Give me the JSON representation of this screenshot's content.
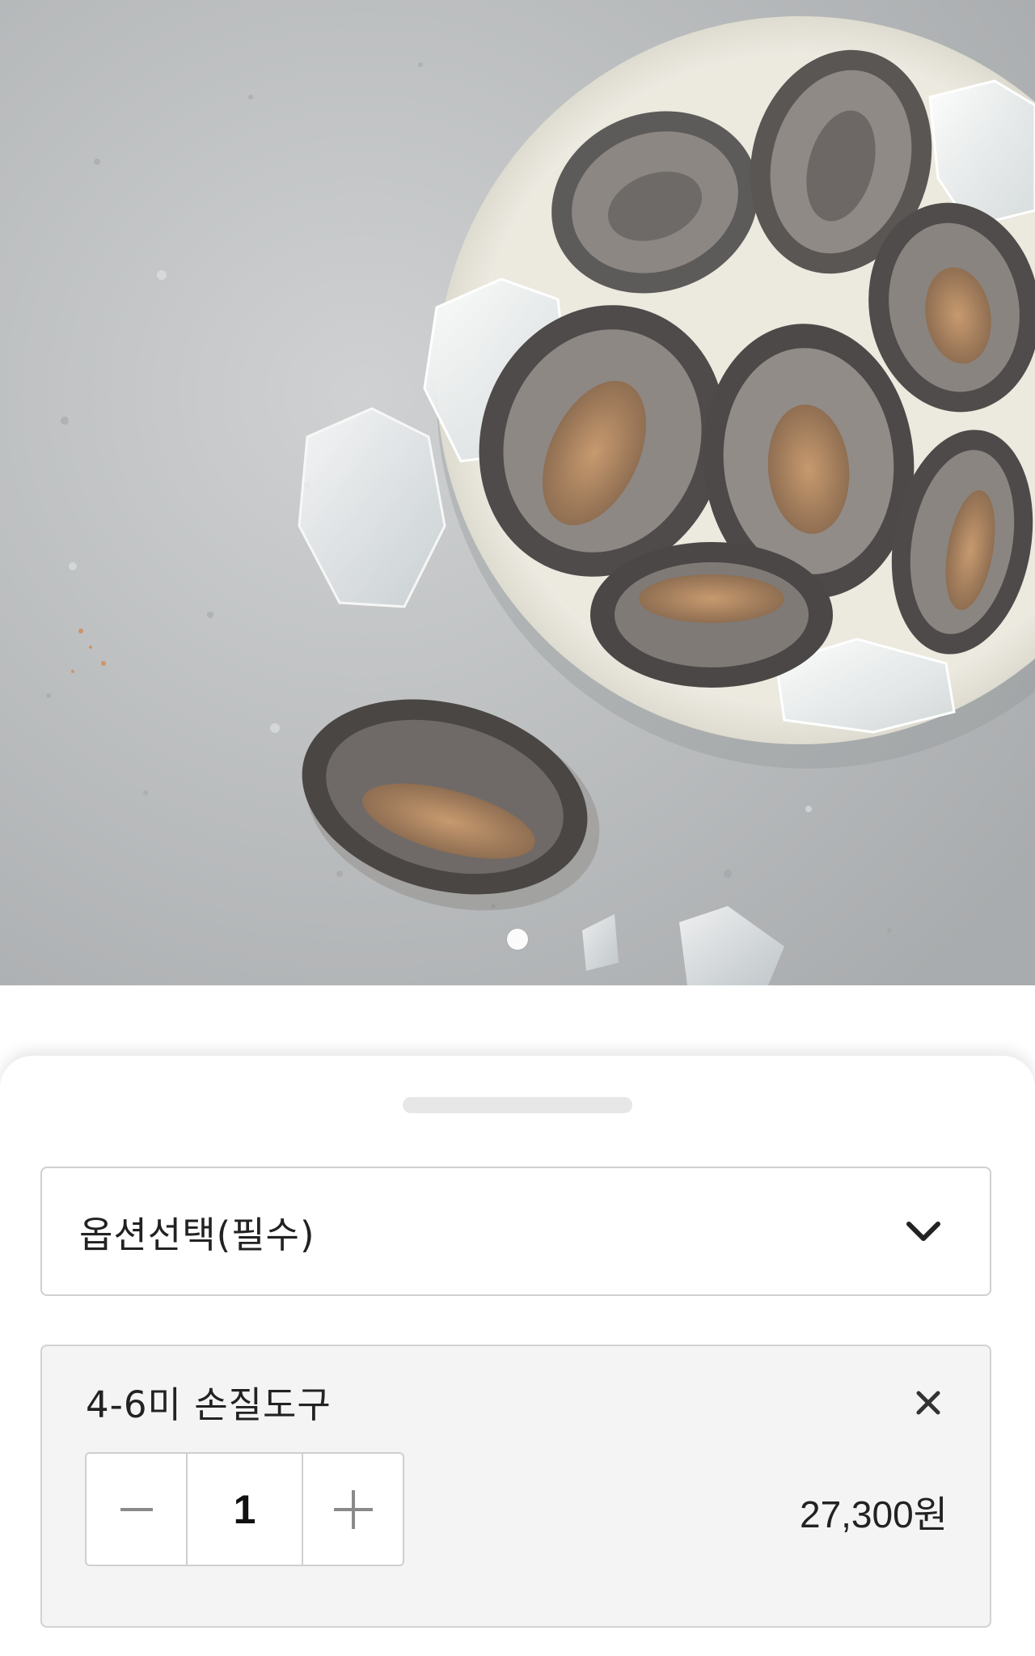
{
  "product_image": {
    "alt": "",
    "carousel_dots": 1,
    "active_index": 0
  },
  "sheet": {
    "option_select": {
      "label": "옵션선택(필수)",
      "icon": "chevron-down-icon"
    },
    "selected_option": {
      "name": "4-6미 손질도구",
      "remove_icon": "close-icon",
      "quantity": "1",
      "decrease_icon": "minus-icon",
      "increase_icon": "plus-icon",
      "price": "27,300원"
    }
  },
  "colors": {
    "background": "#ffffff",
    "border": "#d0d0d0",
    "card_bg": "#f4f4f4",
    "handle": "#e7e7e7"
  }
}
